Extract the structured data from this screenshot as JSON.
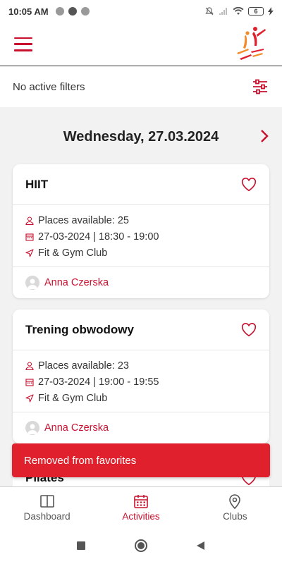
{
  "status_bar": {
    "time": "10:05 AM",
    "battery": "6"
  },
  "filters": {
    "label": "No active filters"
  },
  "date_header": {
    "date": "Wednesday, 27.03.2024"
  },
  "activities": [
    {
      "title": "HIIT",
      "places": "Places available: 25",
      "datetime": "27-03-2024 | 18:30 - 19:00",
      "location": "Fit & Gym Club",
      "trainer": "Anna Czerska"
    },
    {
      "title": "Trening obwodowy",
      "places": "Places available: 23",
      "datetime": "27-03-2024 | 19:00 - 19:55",
      "location": "Fit & Gym Club",
      "trainer": "Anna Czerska"
    },
    {
      "title": "Pilates"
    }
  ],
  "snackbar": {
    "message": "Removed from favorites"
  },
  "bottom_nav": {
    "items": [
      {
        "label": "Dashboard",
        "icon": "book-icon",
        "active": false
      },
      {
        "label": "Activities",
        "icon": "calendar-icon",
        "active": true
      },
      {
        "label": "Clubs",
        "icon": "map-pin-icon",
        "active": false
      }
    ]
  },
  "colors": {
    "accent": "#c8102e",
    "snackbar": "#e0202d"
  }
}
